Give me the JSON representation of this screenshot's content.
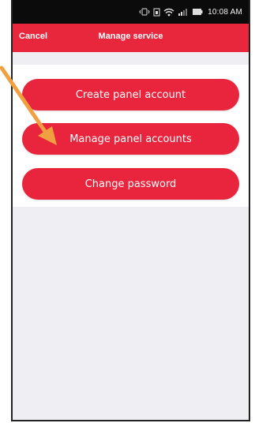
{
  "status_bar": {
    "time": "10:08 AM",
    "icons": [
      "vibrate-icon",
      "sim-icon",
      "wifi-icon",
      "signal-icon",
      "battery-icon"
    ]
  },
  "nav": {
    "cancel_label": "Cancel",
    "title": "Manage service"
  },
  "actions": {
    "create_label": "Create panel account",
    "manage_label": "Manage panel accounts",
    "change_password_label": "Change password"
  },
  "colors": {
    "accent": "#e8273d",
    "status_bar": "#0b0b0b",
    "background": "#efeff3",
    "arrow": "#f0a040"
  }
}
